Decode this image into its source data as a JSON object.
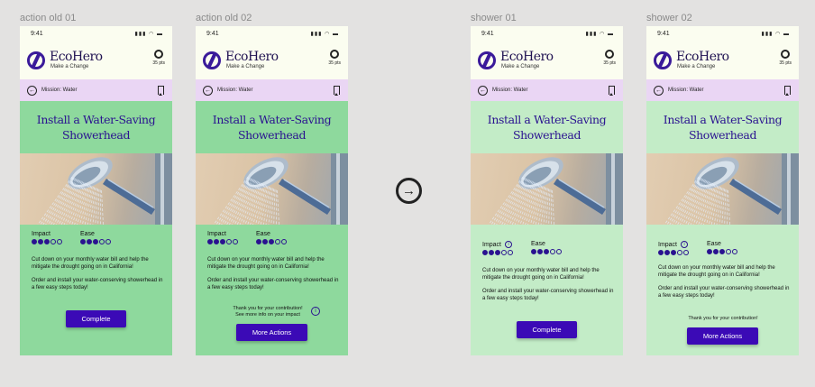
{
  "frames": [
    {
      "frame_title": "action old 01",
      "time": "9:41",
      "brand": "EcoHero",
      "tagline": "Make a Change",
      "points": "35 pts",
      "mission": "Mission: Water",
      "title_line1": "Install a Water-Saving",
      "title_line2": "Showerhead",
      "impact_label": "Impact",
      "ease_label": "Ease",
      "impact_level": 3,
      "ease_level": 3,
      "desc1": "Cut down on your monthly water bill and help the mitigate the drought going on in California!",
      "desc2": "Order and install your water-conserving showerhead in a few easy steps today!",
      "button": "Complete"
    },
    {
      "frame_title": "action old 02",
      "time": "9:41",
      "brand": "EcoHero",
      "tagline": "Make a Change",
      "points": "35 pts",
      "mission": "Mission: Water",
      "title_line1": "Install a Water-Saving",
      "title_line2": "Showerhead",
      "impact_label": "Impact",
      "ease_label": "Ease",
      "impact_level": 3,
      "ease_level": 3,
      "desc1": "Cut down on your monthly water bill and help the mitigate the drought going on in California!",
      "desc2": "Order and install your water-conserving showerhead in a few easy steps today!",
      "thanks_line1": "Thank you for your contribution!",
      "thanks_line2": "See more info on your impact",
      "button": "More Actions"
    },
    {
      "frame_title": "shower 01",
      "time": "9:41",
      "brand": "EcoHero",
      "tagline": "Make a Change",
      "points": "35 pts",
      "mission": "Mission: Water",
      "title_line1": "Install a Water-Saving",
      "title_line2": "Showerhead",
      "impact_label": "Impact",
      "ease_label": "Ease",
      "impact_level": 3,
      "ease_level": 3,
      "desc1": "Cut down on your monthly water bill and help the mitigate the drought going on in California!",
      "desc2": "Order and install your water-conserving showerhead in a few easy steps today!",
      "button": "Complete"
    },
    {
      "frame_title": "shower 02",
      "time": "9:41",
      "brand": "EcoHero",
      "tagline": "Make a Change",
      "points": "35 pts",
      "mission": "Mission: Water",
      "title_line1": "Install a Water-Saving",
      "title_line2": "Showerhead",
      "impact_label": "Impact",
      "ease_label": "Ease",
      "impact_level": 3,
      "ease_level": 3,
      "desc1": "Cut down on your monthly water bill and help the mitigate the drought going on in California!",
      "desc2": "Order and install your water-conserving showerhead in a few easy steps today!",
      "thanks_line1": "Thank you for your contribution!",
      "button": "More Actions"
    }
  ],
  "transition_icon": "arrow-right-circle-icon",
  "colors": {
    "brand": "#2a1290",
    "button": "#3b0ab6",
    "green_old": "#8ed99d",
    "green_new": "#c3ecc7",
    "mission_bar": "#ead6f4",
    "header_bg": "#fbfdf0"
  }
}
